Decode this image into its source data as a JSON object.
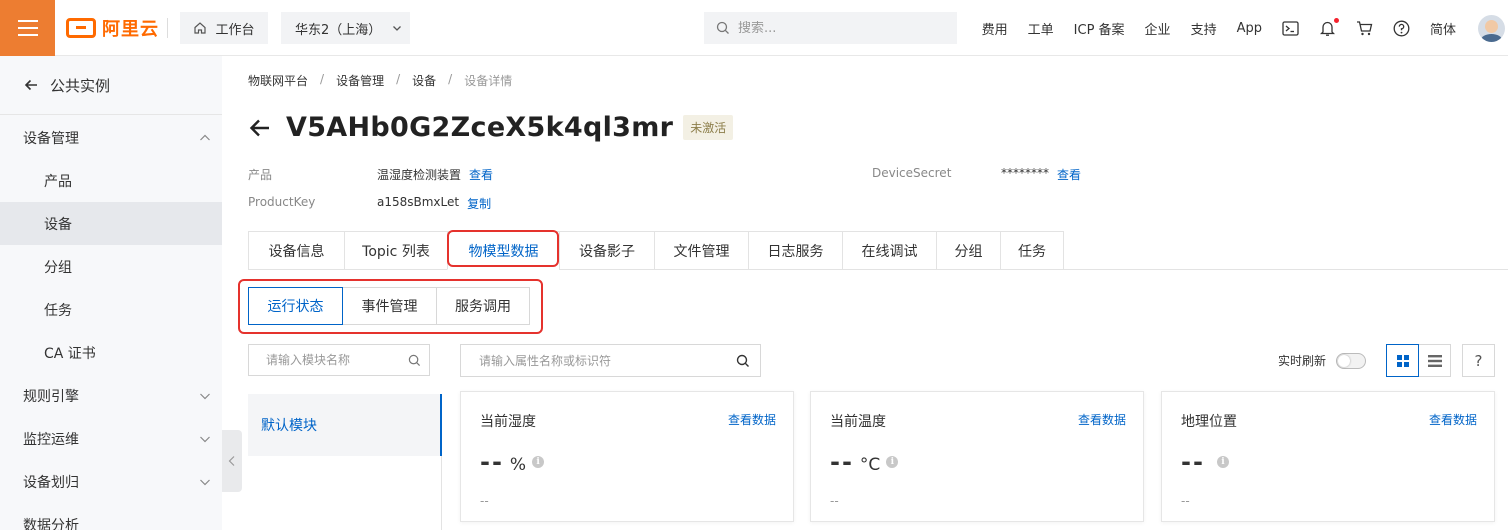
{
  "topbar": {
    "logo_text": "阿里云",
    "workbench_label": "工作台",
    "region_label": "华东2（上海）",
    "search_placeholder": "搜索...",
    "links": [
      "费用",
      "工单",
      "ICP 备案",
      "企业",
      "支持",
      "App"
    ],
    "lang": "简体"
  },
  "sidebar": {
    "back_label": "公共实例",
    "groups": [
      {
        "label": "设备管理",
        "expanded": true,
        "items": [
          "产品",
          "设备",
          "分组",
          "任务",
          "CA 证书"
        ],
        "active_item": "设备"
      },
      {
        "label": "规则引擎",
        "expanded": false
      },
      {
        "label": "监控运维",
        "expanded": false
      },
      {
        "label": "设备划归",
        "expanded": false
      },
      {
        "label": "数据分析",
        "expanded": false
      }
    ]
  },
  "breadcrumb": [
    "物联网平台",
    "设备管理",
    "设备",
    "设备详情"
  ],
  "device": {
    "name": "V5AHb0G2ZceX5k4ql3mr",
    "status": "未激活",
    "product_label": "产品",
    "product_value": "温湿度检测装置",
    "product_link": "查看",
    "productkey_label": "ProductKey",
    "productkey_value": "a158sBmxLet",
    "productkey_link": "复制",
    "secret_label": "DeviceSecret",
    "secret_value": "********",
    "secret_link": "查看"
  },
  "tabs": [
    "设备信息",
    "Topic 列表",
    "物模型数据",
    "设备影子",
    "文件管理",
    "日志服务",
    "在线调试",
    "分组",
    "任务"
  ],
  "active_tab": "物模型数据",
  "subtabs": [
    "运行状态",
    "事件管理",
    "服务调用"
  ],
  "active_subtab": "运行状态",
  "module_search_placeholder": "请输入模块名称",
  "modules": [
    "默认模块"
  ],
  "prop_search_placeholder": "请输入属性名称或标识符",
  "refresh_label": "实时刷新",
  "help_label": "?",
  "cards": [
    {
      "title": "当前湿度",
      "link": "查看数据",
      "value": "--",
      "unit": "%",
      "time": "--"
    },
    {
      "title": "当前温度",
      "link": "查看数据",
      "value": "--",
      "unit": "°C",
      "time": "--"
    },
    {
      "title": "地理位置",
      "link": "查看数据",
      "value": "--",
      "unit": "",
      "time": "--"
    }
  ],
  "colors": {
    "brand": "#ff6a00",
    "accent": "#0064c8",
    "highlight": "#e5322d"
  }
}
